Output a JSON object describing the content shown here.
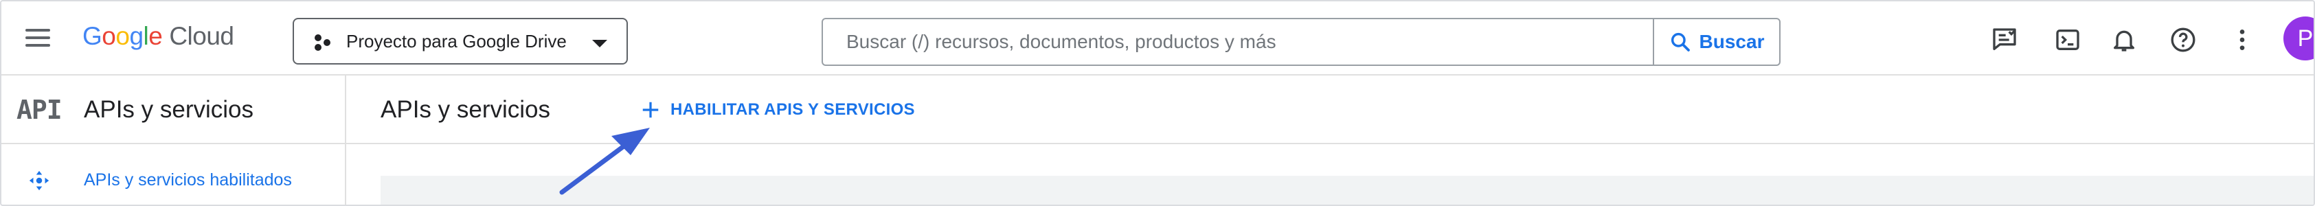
{
  "header": {
    "logo_letters": [
      "G",
      "o",
      "o",
      "g",
      "l",
      "e"
    ],
    "logo_suffix": "Cloud",
    "project_label": "Proyecto para Google Drive",
    "search_placeholder": "Buscar (/) recursos, documentos, productos y más",
    "search_button": "Buscar",
    "avatar_letter": "P",
    "icons": [
      "menu-icon",
      "project-icon",
      "search-icon",
      "notes-icon",
      "terminal-icon",
      "bell-icon",
      "help-icon",
      "more-vert-icon"
    ]
  },
  "sidebar": {
    "badge": "API",
    "title": "APIs y servicios",
    "items": [
      {
        "label": "APIs y servicios habilitados",
        "icon": "move-icon"
      }
    ]
  },
  "main": {
    "title": "APIs y servicios",
    "enable_button": "HABILITAR APIS Y SERVICIOS"
  },
  "colors": {
    "accent": "#1a73e8",
    "avatar": "#9334e6",
    "annotation_arrow": "#3b5fd4"
  }
}
